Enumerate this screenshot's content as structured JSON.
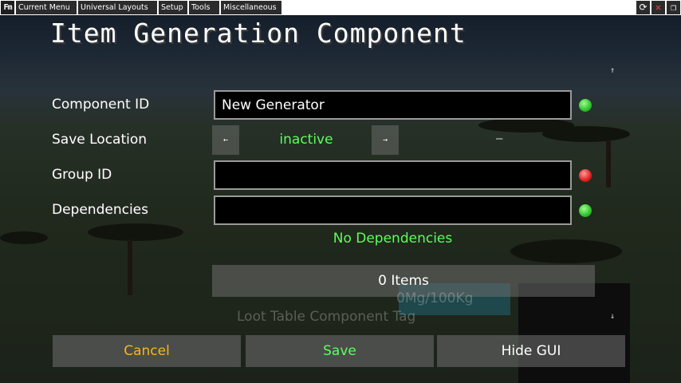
{
  "menubar": {
    "logo": "Fm",
    "items": [
      "Current Menu",
      "Universal Layouts",
      "Setup",
      "Tools",
      "Miscellaneous"
    ],
    "window_buttons": [
      "reload-icon",
      "close-icon",
      "windowed-icon"
    ]
  },
  "title": "Item Generation Component",
  "form": {
    "component_id": {
      "label": "Component ID",
      "value": "New Generator",
      "status": "green"
    },
    "save_location": {
      "label": "Save Location",
      "value": "inactive",
      "prev": "←",
      "next": "→",
      "extra": "—"
    },
    "group_id": {
      "label": "Group ID",
      "value": "",
      "status": "red"
    },
    "dependencies": {
      "label": "Dependencies",
      "value": "",
      "status": "green",
      "note": "No Dependencies"
    }
  },
  "items_button": "0 Items",
  "background_ghost": {
    "weight": "0Mg/100Kg",
    "tag": "Loot Table Component Tag"
  },
  "scroll": {
    "up": "↑",
    "down": "↓"
  },
  "buttons": {
    "cancel": {
      "label": "Cancel",
      "color": "#ffb020"
    },
    "save": {
      "label": "Save",
      "color": "#5cff5c"
    },
    "hide": {
      "label": "Hide GUI",
      "color": "#ffffff"
    }
  }
}
